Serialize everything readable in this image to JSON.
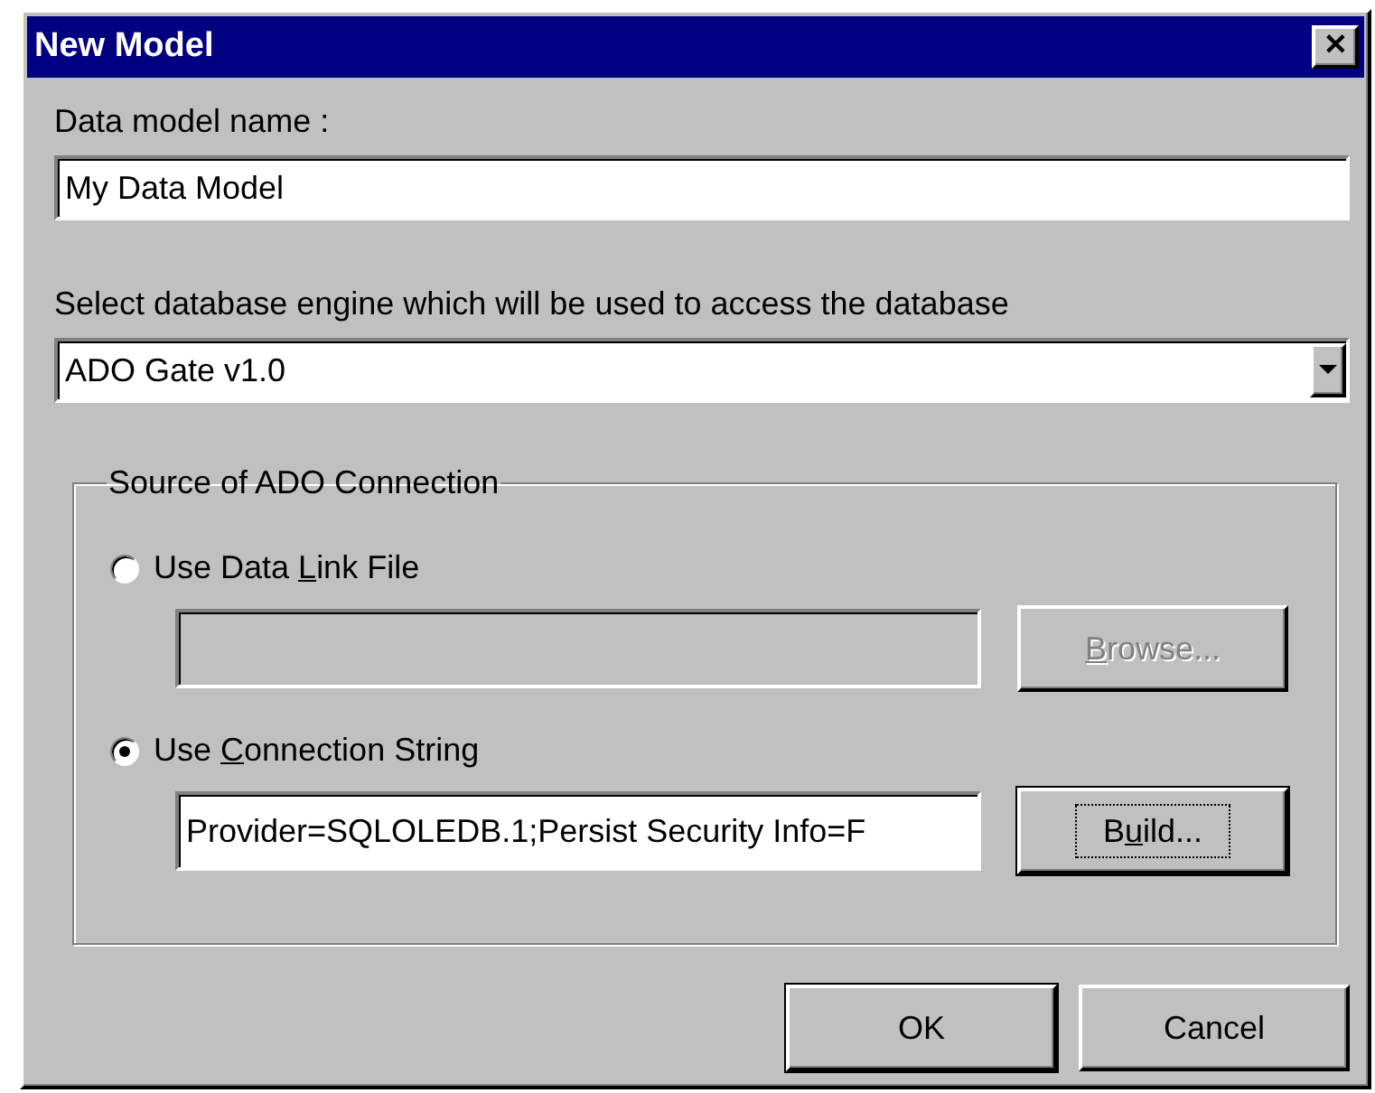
{
  "window": {
    "title": "New Model",
    "close_glyph": "✕"
  },
  "name_field": {
    "label": "Data model name :",
    "value": "My Data Model"
  },
  "engine": {
    "label": "Select database engine which will be used to access the database",
    "value": "ADO Gate v1.0"
  },
  "group": {
    "title": "Source of ADO Connection",
    "options": [
      {
        "label_before": "Use Data ",
        "access_key": "L",
        "label_after": "ink File",
        "selected": false,
        "button": {
          "key": "B",
          "after": "rowse...",
          "disabled": true,
          "focused": false
        }
      },
      {
        "label_before": "Use ",
        "access_key": "C",
        "label_after": "onnection String",
        "selected": true,
        "value": "Provider=SQLOLEDB.1;Persist Security Info=F",
        "button": {
          "before": "B",
          "key": "u",
          "after": "ild...",
          "disabled": false,
          "focused": true
        }
      }
    ]
  },
  "buttons": [
    {
      "label": "OK",
      "default": true
    },
    {
      "label": "Cancel",
      "default": false
    }
  ]
}
